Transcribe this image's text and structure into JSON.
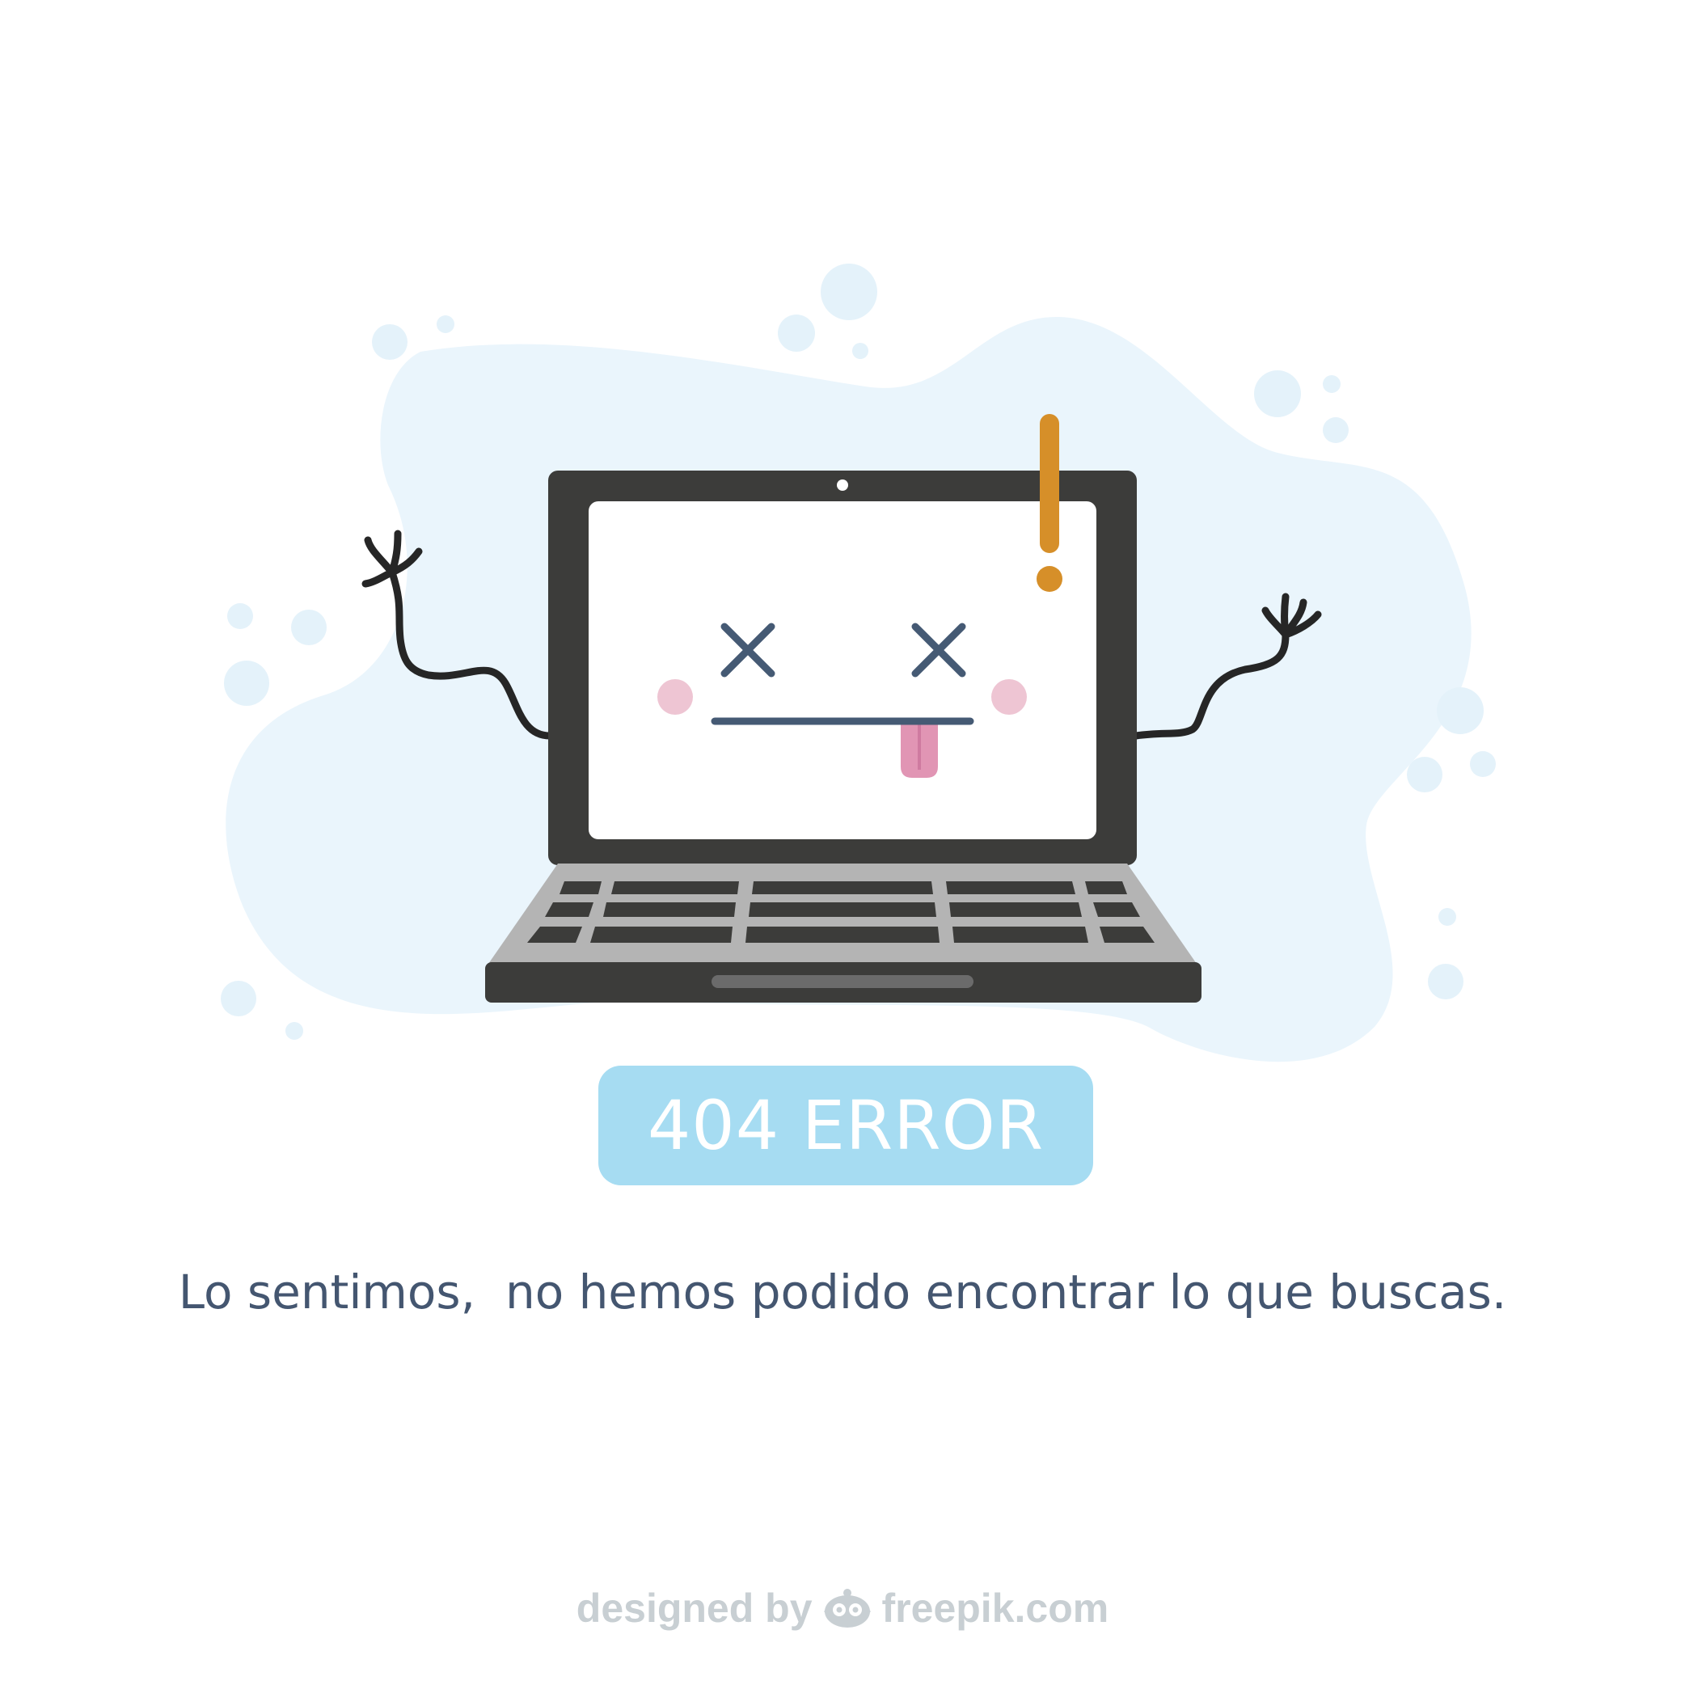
{
  "error": {
    "badge_text": "404 ERROR",
    "message": "Lo sentimos,  no hemos podido encontrar lo que buscas."
  },
  "credit": {
    "prefix": "designed by",
    "brand": "freepik.com"
  },
  "icons": {
    "warning": "exclamation-icon",
    "eyes": "x-eye-icon",
    "brand": "freepik-owl-icon"
  },
  "colors": {
    "blob": "#eaf5fc",
    "laptop_body": "#3c3c3a",
    "keyboard": "#b4b4b4",
    "exclamation": "#d68f29",
    "badge": "#a6dcf2",
    "message_text": "#445670",
    "face": "#455a74",
    "tongue": "#e195b4",
    "cheek": "#eec5d3"
  }
}
